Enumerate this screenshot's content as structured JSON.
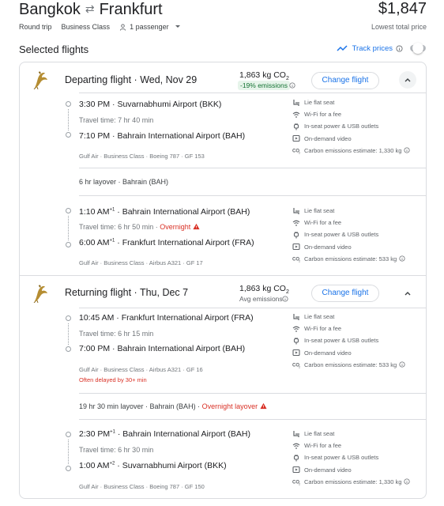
{
  "header": {
    "origin": "Bangkok",
    "destination": "Frankfurt",
    "trip_type": "Round trip",
    "cabin": "Business Class",
    "passengers": "1 passenger",
    "price": "$1,847",
    "price_note": "Lowest total price"
  },
  "selected_title": "Selected flights",
  "track_prices_label": "Track prices",
  "colors": {
    "accent": "#1a73e8",
    "warning": "#d93025",
    "positive": "#137333"
  },
  "amenity_labels": {
    "seat": "Lie flat seat",
    "wifi": "Wi-Fi for a fee",
    "power": "In-seat power & USB outlets",
    "video": "On-demand video"
  },
  "departing": {
    "title": "Departing flight",
    "date": "Wed, Nov 29",
    "co2": "1,863 kg CO",
    "co2_sub": "2",
    "emissions_badge": "-19% emissions",
    "button": "Change flight",
    "leg1": {
      "dep_time": "3:30 PM",
      "dep_airport": "Suvarnabhumi Airport (BKK)",
      "travel": "Travel time: 7 hr 40 min",
      "arr_time": "7:10 PM",
      "arr_airport": "Bahrain International Airport (BAH)",
      "meta": "Gulf Air · Business Class · Boeing 787 · GF 153",
      "carbon": "Carbon emissions estimate: 1,330 kg"
    },
    "layover": "6 hr layover · Bahrain (BAH)",
    "leg2": {
      "dep_time": "1:10 AM",
      "dep_sup": "+1",
      "dep_airport": "Bahrain International Airport (BAH)",
      "travel": "Travel time: 6 hr 50 min · ",
      "travel_warning": "Overnight",
      "arr_time": "6:00 AM",
      "arr_sup": "+1",
      "arr_airport": "Frankfurt International Airport (FRA)",
      "meta": "Gulf Air · Business Class · Airbus A321 · GF 17",
      "carbon": "Carbon emissions estimate: 533 kg"
    }
  },
  "returning": {
    "title": "Returning flight",
    "date": "Thu, Dec 7",
    "co2": "1,863 kg CO",
    "co2_sub": "2",
    "emissions_note": "Avg emissions",
    "button": "Change flight",
    "leg1": {
      "dep_time": "10:45 AM",
      "dep_airport": "Frankfurt International Airport (FRA)",
      "travel": "Travel time: 6 hr 15 min",
      "arr_time": "7:00 PM",
      "arr_airport": "Bahrain International Airport (BAH)",
      "meta": "Gulf Air · Business Class · Airbus A321 · GF 16",
      "delay": "Often delayed by 30+ min",
      "carbon": "Carbon emissions estimate: 533 kg"
    },
    "layover": "19 hr 30 min layover · Bahrain (BAH) · ",
    "layover_warning": "Overnight layover",
    "leg2": {
      "dep_time": "2:30 PM",
      "dep_sup": "+1",
      "dep_airport": "Bahrain International Airport (BAH)",
      "travel": "Travel time: 6 hr 30 min",
      "arr_time": "1:00 AM",
      "arr_sup": "+2",
      "arr_airport": "Suvarnabhumi Airport (BKK)",
      "meta": "Gulf Air · Business Class · Boeing 787 · GF 150",
      "carbon": "Carbon emissions estimate: 1,330 kg"
    }
  }
}
